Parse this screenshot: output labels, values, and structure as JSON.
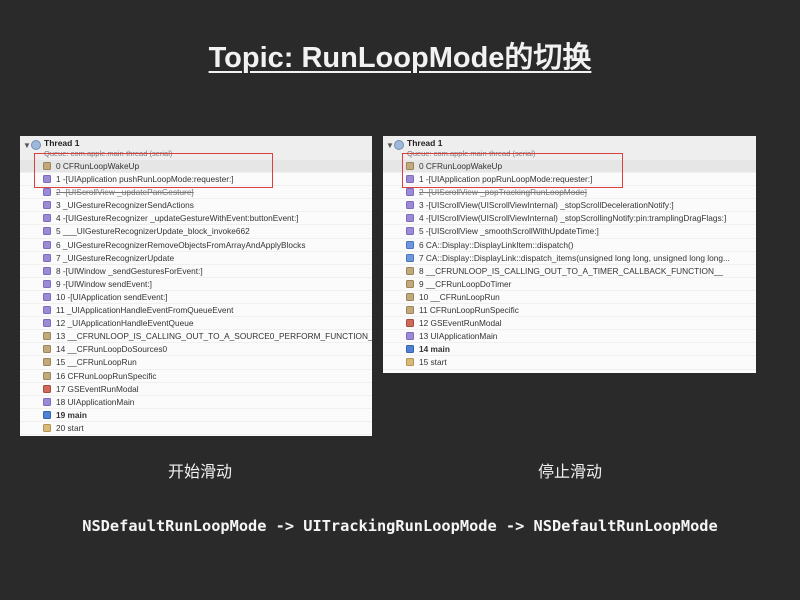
{
  "title": "Topic: RunLoopMode的切换",
  "left_panel": {
    "thread_name": "Thread 1",
    "thread_queue": "Queue: com.apple.main-thread (serial)",
    "caption": "开始滑动",
    "frames": [
      {
        "label": "0 CFRunLoopWakeUp",
        "icon": "ic-brown"
      },
      {
        "label": "1 -[UIApplication pushRunLoopMode:requester:]",
        "icon": "ic-purple"
      },
      {
        "label": "2 -[UIScrollView _updatePanGesture]",
        "icon": "ic-purple",
        "strike": true
      },
      {
        "label": "3 _UIGestureRecognizerSendActions",
        "icon": "ic-purple"
      },
      {
        "label": "4 -[UIGestureRecognizer _updateGestureWithEvent:buttonEvent:]",
        "icon": "ic-purple"
      },
      {
        "label": "5 ___UIGestureRecognizerUpdate_block_invoke662",
        "icon": "ic-purple"
      },
      {
        "label": "6 _UIGestureRecognizerRemoveObjectsFromArrayAndApplyBlocks",
        "icon": "ic-purple"
      },
      {
        "label": "7 _UIGestureRecognizerUpdate",
        "icon": "ic-purple"
      },
      {
        "label": "8 -[UIWindow _sendGesturesForEvent:]",
        "icon": "ic-purple"
      },
      {
        "label": "9 -[UIWindow sendEvent:]",
        "icon": "ic-purple"
      },
      {
        "label": "10 -[UIApplication sendEvent:]",
        "icon": "ic-purple"
      },
      {
        "label": "11 _UIApplicationHandleEventFromQueueEvent",
        "icon": "ic-purple"
      },
      {
        "label": "12 _UIApplicationHandleEventQueue",
        "icon": "ic-purple"
      },
      {
        "label": "13 __CFRUNLOOP_IS_CALLING_OUT_TO_A_SOURCE0_PERFORM_FUNCTION__",
        "icon": "ic-brown"
      },
      {
        "label": "14 __CFRunLoopDoSources0",
        "icon": "ic-brown"
      },
      {
        "label": "15 __CFRunLoopRun",
        "icon": "ic-brown"
      },
      {
        "label": "16 CFRunLoopRunSpecific",
        "icon": "ic-brown"
      },
      {
        "label": "17 GSEventRunModal",
        "icon": "ic-red"
      },
      {
        "label": "18 UIApplicationMain",
        "icon": "ic-purple"
      },
      {
        "label": "19 main",
        "icon": "ic-user",
        "bold": true
      },
      {
        "label": "20 start",
        "icon": "ic-start"
      }
    ]
  },
  "right_panel": {
    "thread_name": "Thread 1",
    "thread_queue": "Queue: com.apple.main-thread (serial)",
    "caption": "停止滑动",
    "frames": [
      {
        "label": "0 CFRunLoopWakeUp",
        "icon": "ic-brown"
      },
      {
        "label": "1 -[UIApplication popRunLoopMode:requester:]",
        "icon": "ic-purple"
      },
      {
        "label": "2 -[UIScrollView _popTrackingRunLoopMode]",
        "icon": "ic-purple",
        "strike": true
      },
      {
        "label": "3 -[UIScrollView(UIScrollViewInternal) _stopScrollDecelerationNotify:]",
        "icon": "ic-purple"
      },
      {
        "label": "4 -[UIScrollView(UIScrollViewInternal) _stopScrollingNotify:pin:tramplingDragFlags:]",
        "icon": "ic-purple"
      },
      {
        "label": "5 -[UIScrollView _smoothScrollWithUpdateTime:]",
        "icon": "ic-purple"
      },
      {
        "label": "6 CA::Display::DisplayLinkItem::dispatch()",
        "icon": "ic-blue"
      },
      {
        "label": "7 CA::Display::DisplayLink::dispatch_items(unsigned long long, unsigned long long...",
        "icon": "ic-blue"
      },
      {
        "label": "8 __CFRUNLOOP_IS_CALLING_OUT_TO_A_TIMER_CALLBACK_FUNCTION__",
        "icon": "ic-brown"
      },
      {
        "label": "9 __CFRunLoopDoTimer",
        "icon": "ic-brown"
      },
      {
        "label": "10 __CFRunLoopRun",
        "icon": "ic-brown"
      },
      {
        "label": "11 CFRunLoopRunSpecific",
        "icon": "ic-brown"
      },
      {
        "label": "12 GSEventRunModal",
        "icon": "ic-red"
      },
      {
        "label": "13 UIApplicationMain",
        "icon": "ic-purple"
      },
      {
        "label": "14 main",
        "icon": "ic-user",
        "bold": true
      },
      {
        "label": "15 start",
        "icon": "ic-start"
      }
    ]
  },
  "bottom_text": "NSDefaultRunLoopMode -> UITrackingRunLoopMode -> NSDefaultRunLoopMode",
  "colors": {
    "background": "#2a2a2a",
    "highlight": "#d8413e"
  }
}
